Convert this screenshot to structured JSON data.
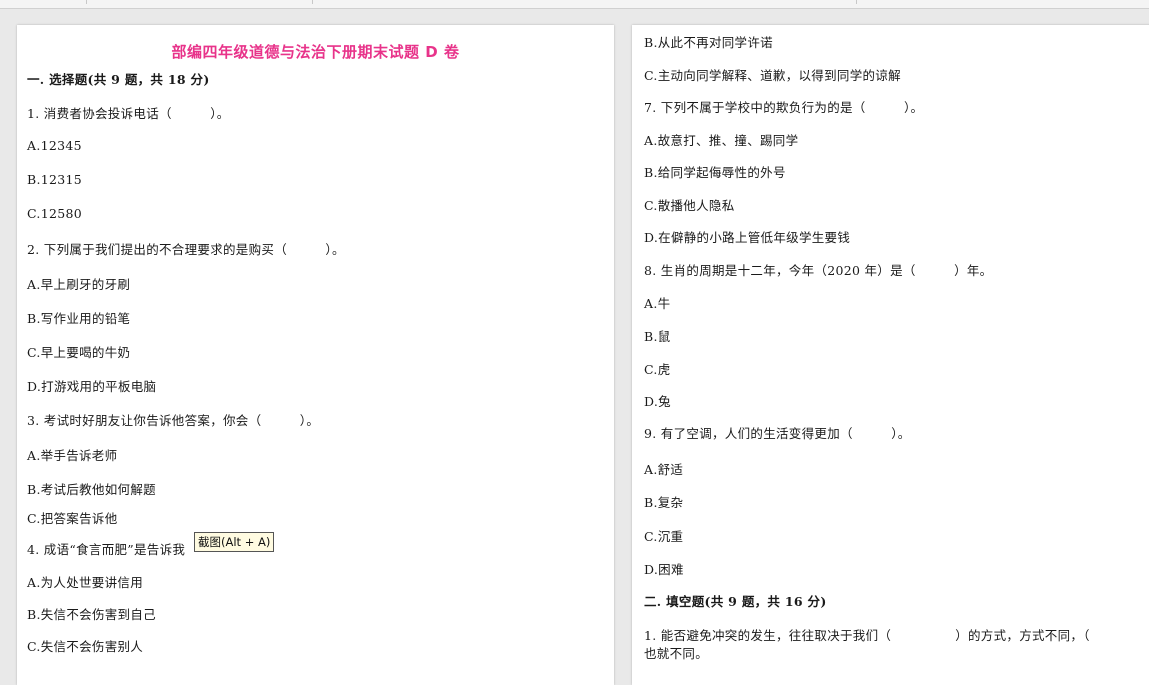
{
  "left": {
    "title": "部编四年级道德与法治下册期末试题 D 卷",
    "lines": [
      "一. 选择题(共 9 题，共 18 分)",
      "1. 消费者协会投诉电话（　　　）。",
      "A.12345",
      "B.12315",
      "C.12580",
      "2. 下列属于我们提出的不合理要求的是购买（　　　）。",
      "A.早上刷牙的牙刷",
      "B.写作业用的铅笔",
      "C.早上要喝的牛奶",
      "D.打游戏用的平板电脑",
      "3. 考试时好朋友让你告诉他答案，你会（　　　）。",
      "A.举手告诉老师",
      "B.考试后教他如何解题",
      "C.把答案告诉他",
      "4. 成语“食言而肥”是告诉我",
      "A.为人处世要讲信用",
      "B.失信不会伤害到自己",
      "C.失信不会伤害别人"
    ]
  },
  "right": {
    "lines": [
      "B.从此不再对同学许诺",
      "C.主动向同学解释、道歉，以得到同学的谅解",
      "7. 下列不属于学校中的欺负行为的是（　　　）。",
      "A.故意打、推、撞、踢同学",
      "B.给同学起侮辱性的外号",
      "C.散播他人隐私",
      "D.在僻静的小路上管低年级学生要钱",
      "8. 生肖的周期是十二年，今年（2020 年）是（　　　）年。",
      "A.牛",
      "B.鼠",
      "C.虎",
      "D.兔",
      "9. 有了空调，人们的生活变得更加（　　　）。",
      "A.舒适",
      "B.复杂",
      "C.沉重",
      "D.困难",
      "二. 填空题(共 9 题，共 16 分)",
      "1. 能否避免冲突的发生，往往取决于我们（　　　　　）的方式，方式不同，（",
      "也就不同。"
    ]
  },
  "tooltip": "截图(Alt + A)"
}
